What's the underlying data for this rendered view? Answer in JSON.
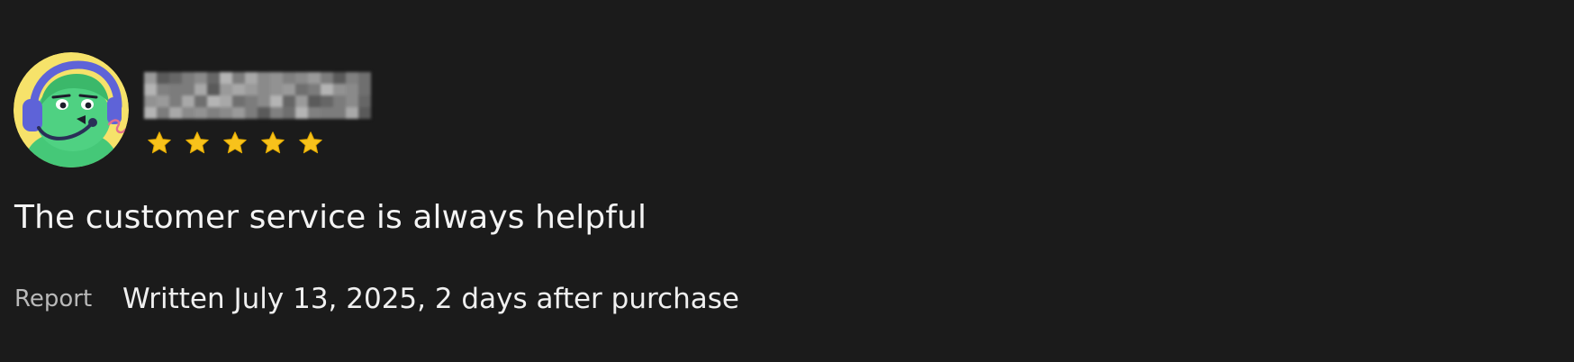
{
  "review": {
    "avatar_icon": "headset-character-avatar",
    "username_redacted": true,
    "rating": 5,
    "rating_max": 5,
    "text": "The customer service is always helpful",
    "report_label": "Report",
    "written_text": "Written July 13, 2025, 2 days after purchase"
  },
  "colors": {
    "background": "#1b1b1b",
    "star": "#f8c21b",
    "avatar_bg": "#f6e26a",
    "avatar_character": "#45c878",
    "headset": "#5e63d8",
    "report_text": "#b9b9b9"
  }
}
